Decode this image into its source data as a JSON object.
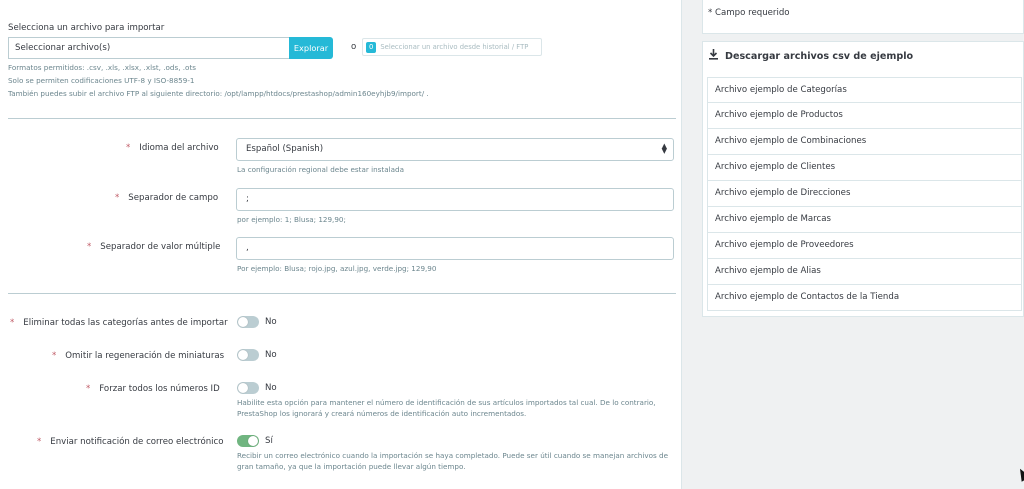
{
  "import_file": {
    "heading": "Selecciona un archivo para importar",
    "file_placeholder": "Seleccionar archivo(s)",
    "explore_label": "Explorar",
    "or_text": "o",
    "history_badge": "0",
    "history_label": "Seleccionar un archivo desde historial / FTP",
    "help_formats": "Formatos permitidos: .csv, .xls, .xlsx, .xlst, .ods, .ots",
    "help_encodings": "Solo se permiten codificaciones UTF-8 y ISO-8859-1",
    "help_ftp": "También puedes subir el archivo FTP al siguiente directorio: /opt/lampp/htdocs/prestashop/admin160eyhjb9/import/ ."
  },
  "fields": {
    "language": {
      "label": "Idioma del archivo",
      "value": "Español (Spanish)",
      "help": "La configuración regional debe estar instalada"
    },
    "field_separator": {
      "label": "Separador de campo",
      "value": ";",
      "help": "por ejemplo: 1; Blusa; 129,90;"
    },
    "multi_separator": {
      "label": "Separador de valor múltiple",
      "value": ",",
      "help": "Por ejemplo: Blusa; rojo.jpg, azul.jpg, verde.jpg; 129,90"
    }
  },
  "options": {
    "delete_categories": {
      "label": "Eliminar todas las categorías antes de importar",
      "state": "No",
      "on": false
    },
    "skip_thumbnails": {
      "label": "Omitir la regeneración de miniaturas",
      "state": "No",
      "on": false
    },
    "force_ids": {
      "label": "Forzar todos los números ID",
      "state": "No",
      "on": false,
      "help": "Habilite esta opción para mantener el número de identificación de sus artículos importados tal cual. De lo contrario, PrestaShop los ignorará y creará números de identificación auto incrementados."
    },
    "email_notification": {
      "label": "Enviar notificación de correo electrónico",
      "state": "Sí",
      "on": true,
      "help": "Recibir un correo electrónico cuando la importación se haya completado. Puede ser útil cuando se manejan archivos de gran tamaño, ya que la importación puede llevar algún tiempo."
    }
  },
  "required_mark": "*",
  "sidebar": {
    "required_note": "* Campo requerido",
    "download_title": "Descargar archivos csv de ejemplo",
    "samples": [
      "Archivo ejemplo de Categorías",
      "Archivo ejemplo de Productos",
      "Archivo ejemplo de Combinaciones",
      "Archivo ejemplo de Clientes",
      "Archivo ejemplo de Direcciones",
      "Archivo ejemplo de Marcas",
      "Archivo ejemplo de Proveedores",
      "Archivo ejemplo de Alias",
      "Archivo ejemplo de Contactos de la Tienda"
    ]
  },
  "colors": {
    "accent": "#25b9d7",
    "switch_on": "#70b580",
    "required": "#c05c67"
  }
}
